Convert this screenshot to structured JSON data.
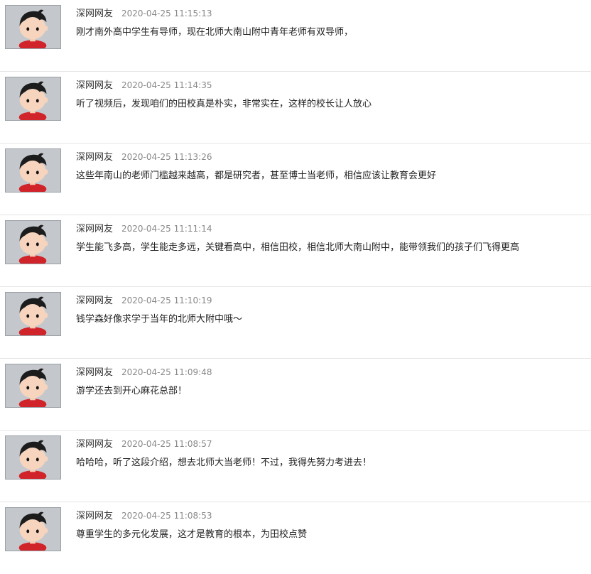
{
  "comments": [
    {
      "user": "深网网友",
      "time": "2020-04-25 11:15:13",
      "text": "刚才南外高中学生有导师，现在北师大南山附中青年老师有双导师，",
      "avatar_icon": "cartoon-boy-avatar-icon"
    },
    {
      "user": "深网网友",
      "time": "2020-04-25 11:14:35",
      "text": "听了视频后，发现咱们的田校真是朴实，非常实在，这样的校长让人放心",
      "avatar_icon": "cartoon-boy-avatar-icon"
    },
    {
      "user": "深网网友",
      "time": "2020-04-25 11:13:26",
      "text": "这些年南山的老师门槛越来越高，都是研究者，甚至博士当老师，相信应该让教育会更好",
      "avatar_icon": "cartoon-boy-avatar-icon"
    },
    {
      "user": "深网网友",
      "time": "2020-04-25 11:11:14",
      "text": "学生能飞多高，学生能走多远，关键看高中，相信田校，相信北师大南山附中，能带领我们的孩子们飞得更高",
      "avatar_icon": "cartoon-boy-avatar-icon"
    },
    {
      "user": "深网网友",
      "time": "2020-04-25 11:10:19",
      "text": "钱学森好像求学于当年的北师大附中哦～",
      "avatar_icon": "cartoon-boy-avatar-icon"
    },
    {
      "user": "深网网友",
      "time": "2020-04-25 11:09:48",
      "text": "游学还去到开心麻花总部！",
      "avatar_icon": "cartoon-boy-avatar-icon"
    },
    {
      "user": "深网网友",
      "time": "2020-04-25 11:08:57",
      "text": "哈哈哈，听了这段介绍，想去北师大当老师！不过，我得先努力考进去！",
      "avatar_icon": "cartoon-boy-avatar-icon"
    },
    {
      "user": "深网网友",
      "time": "2020-04-25 11:08:53",
      "text": "尊重学生的多元化发展，这才是教育的根本，为田校点赞",
      "avatar_icon": "cartoon-boy-avatar-icon"
    }
  ],
  "colors": {
    "avatar_bg": "#c4c8cc",
    "divider": "#e5e5e5",
    "username": "#333333",
    "timestamp": "#888888",
    "text": "#222222"
  }
}
